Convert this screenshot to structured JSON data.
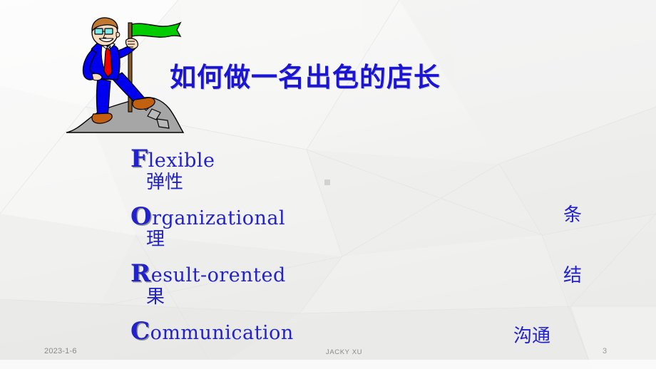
{
  "slide": {
    "title": "如何做一名出色的店长",
    "page_number": "3",
    "date": "2023-1-6",
    "author": "JACKY  XU",
    "colors": {
      "text_blue": "#2222cc",
      "title_blue": "#1a14d6",
      "suit_blue": "#0000EE",
      "tie_red": "#EE0000",
      "flag_green": "#00CC00",
      "rock_gray": "#a6a6a6",
      "shoe_brown": "#C06010",
      "hair_brown": "#C07830",
      "background": "#f2f2f1"
    },
    "body_items": [
      {
        "cap": "F",
        "rest": "lexible",
        "cn": "弹性"
      },
      {
        "cap": "O",
        "rest": "rganizational",
        "cn": "理"
      },
      {
        "cap": "R",
        "rest": "esult-orented",
        "cn": "果"
      },
      {
        "cap": "C",
        "rest": "ommunication",
        "cn": ""
      }
    ],
    "right_column": [
      "",
      "条",
      "结",
      "沟通"
    ],
    "clipart": {
      "name": "businessman-with-flag-on-rock",
      "description": "Cartoon businessman in blue suit and red tie holding a green flag while standing on a gray rock"
    }
  }
}
